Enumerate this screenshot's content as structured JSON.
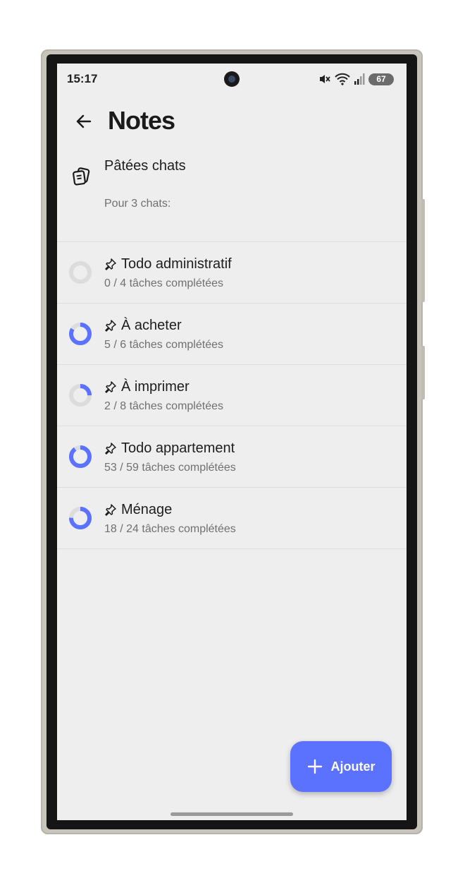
{
  "colors": {
    "accent": "#5b71ff",
    "ring_track": "#dcdcdc",
    "background": "#eeeeee"
  },
  "status_bar": {
    "time": "15:17",
    "battery": "67",
    "icons": [
      "mute-icon",
      "wifi-icon",
      "signal-icon",
      "battery-icon"
    ]
  },
  "header": {
    "title": "Notes",
    "back_icon": "arrow-left-icon"
  },
  "note": {
    "icon": "notes-icon",
    "title": "Pâtées chats",
    "subtitle": "Pour 3 chats:"
  },
  "tasks": [
    {
      "title": "Todo administratif",
      "done": 0,
      "total": 4,
      "progress_text": "0 / 4 tâches complétées"
    },
    {
      "title": "À acheter",
      "done": 5,
      "total": 6,
      "progress_text": "5 / 6 tâches complétées"
    },
    {
      "title": "À imprimer",
      "done": 2,
      "total": 8,
      "progress_text": "2 / 8 tâches complétées"
    },
    {
      "title": "Todo appartement",
      "done": 53,
      "total": 59,
      "progress_text": "53 / 59 tâches complétées"
    },
    {
      "title": "Ménage",
      "done": 18,
      "total": 24,
      "progress_text": "18 / 24 tâches complétées"
    }
  ],
  "fab": {
    "label": "Ajouter",
    "icon": "plus-icon"
  }
}
